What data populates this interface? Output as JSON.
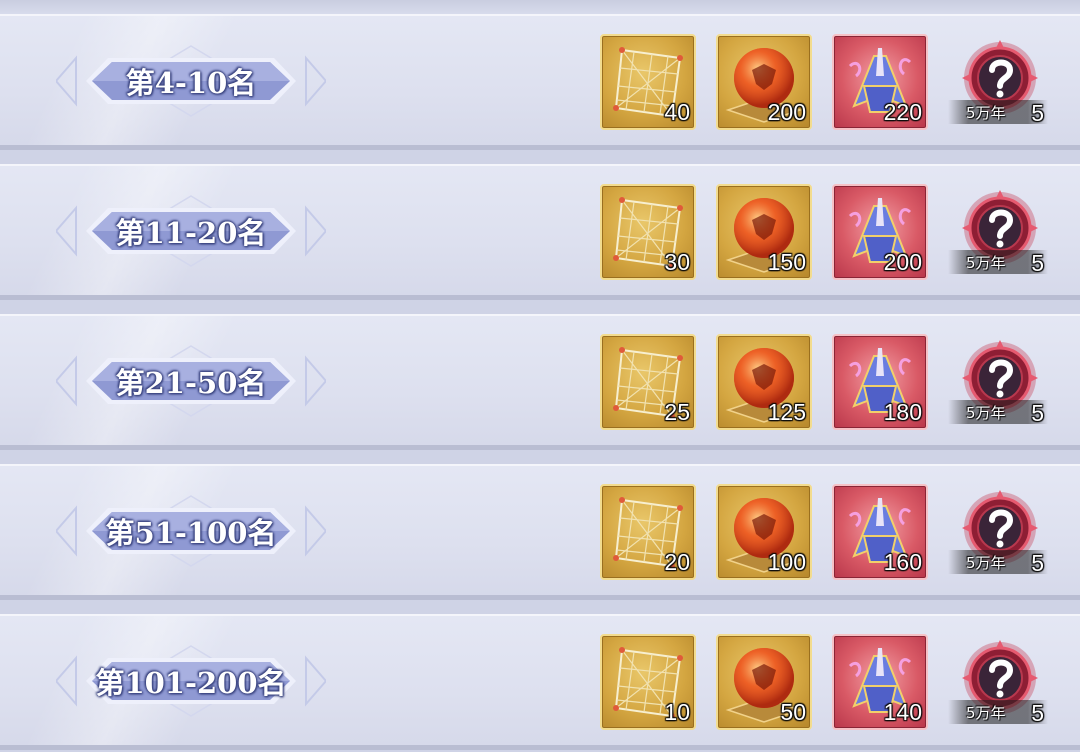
{
  "rows": [
    {
      "rank_label": "第4-10名",
      "rewards": [
        {
          "item": "golden-net",
          "qty": "40"
        },
        {
          "item": "fire-orb",
          "qty": "200"
        },
        {
          "item": "armor-fragment",
          "qty": "220"
        }
      ],
      "mystery": {
        "tag": "5万年",
        "qty": "5"
      }
    },
    {
      "rank_label": "第11-20名",
      "rewards": [
        {
          "item": "golden-net",
          "qty": "30"
        },
        {
          "item": "fire-orb",
          "qty": "150"
        },
        {
          "item": "armor-fragment",
          "qty": "200"
        }
      ],
      "mystery": {
        "tag": "5万年",
        "qty": "5"
      }
    },
    {
      "rank_label": "第21-50名",
      "rewards": [
        {
          "item": "golden-net",
          "qty": "25"
        },
        {
          "item": "fire-orb",
          "qty": "125"
        },
        {
          "item": "armor-fragment",
          "qty": "180"
        }
      ],
      "mystery": {
        "tag": "5万年",
        "qty": "5"
      }
    },
    {
      "rank_label": "第51-100名",
      "rewards": [
        {
          "item": "golden-net",
          "qty": "20"
        },
        {
          "item": "fire-orb",
          "qty": "100"
        },
        {
          "item": "armor-fragment",
          "qty": "160"
        }
      ],
      "mystery": {
        "tag": "5万年",
        "qty": "5"
      }
    },
    {
      "rank_label": "第101-200名",
      "rewards": [
        {
          "item": "golden-net",
          "qty": "10"
        },
        {
          "item": "fire-orb",
          "qty": "50"
        },
        {
          "item": "armor-fragment",
          "qty": "140"
        }
      ],
      "mystery": {
        "tag": "5万年",
        "qty": "5"
      }
    }
  ],
  "colors": {
    "row_bg": "#e1e4f2",
    "badge_fill": "#8e98d2",
    "badge_border": "#eef0fb",
    "gold_frame": "#d4a641",
    "red_frame": "#d95a66",
    "mystery_ring": "#c2324a"
  }
}
